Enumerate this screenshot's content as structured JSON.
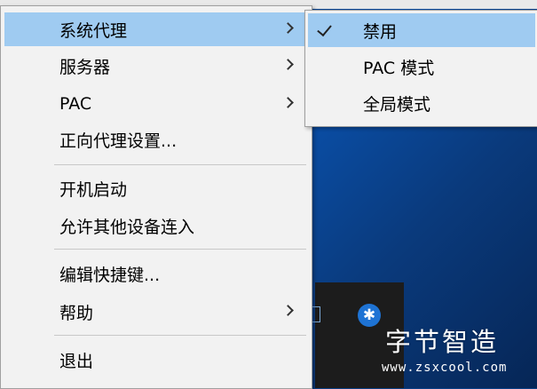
{
  "main_menu": {
    "items": [
      {
        "label": "系统代理"
      },
      {
        "label": "服务器"
      },
      {
        "label": "PAC"
      },
      {
        "label": "正向代理设置..."
      },
      {
        "label": "开机启动"
      },
      {
        "label": "允许其他设备连入"
      },
      {
        "label": "编辑快捷键..."
      },
      {
        "label": "帮助"
      },
      {
        "label": "退出"
      }
    ]
  },
  "submenu": {
    "items": [
      {
        "label": "禁用",
        "checked": true
      },
      {
        "label": "PAC 模式"
      },
      {
        "label": "全局模式"
      }
    ]
  },
  "tray": {
    "bluetooth_icon_glyph": "✱"
  },
  "watermark": {
    "title": "字节智造",
    "url": "www.zsxcool.com"
  },
  "colors": {
    "highlight": "#9fcbf1",
    "menu_bg": "#f2f2f2",
    "bluetooth": "#1e73d4"
  }
}
